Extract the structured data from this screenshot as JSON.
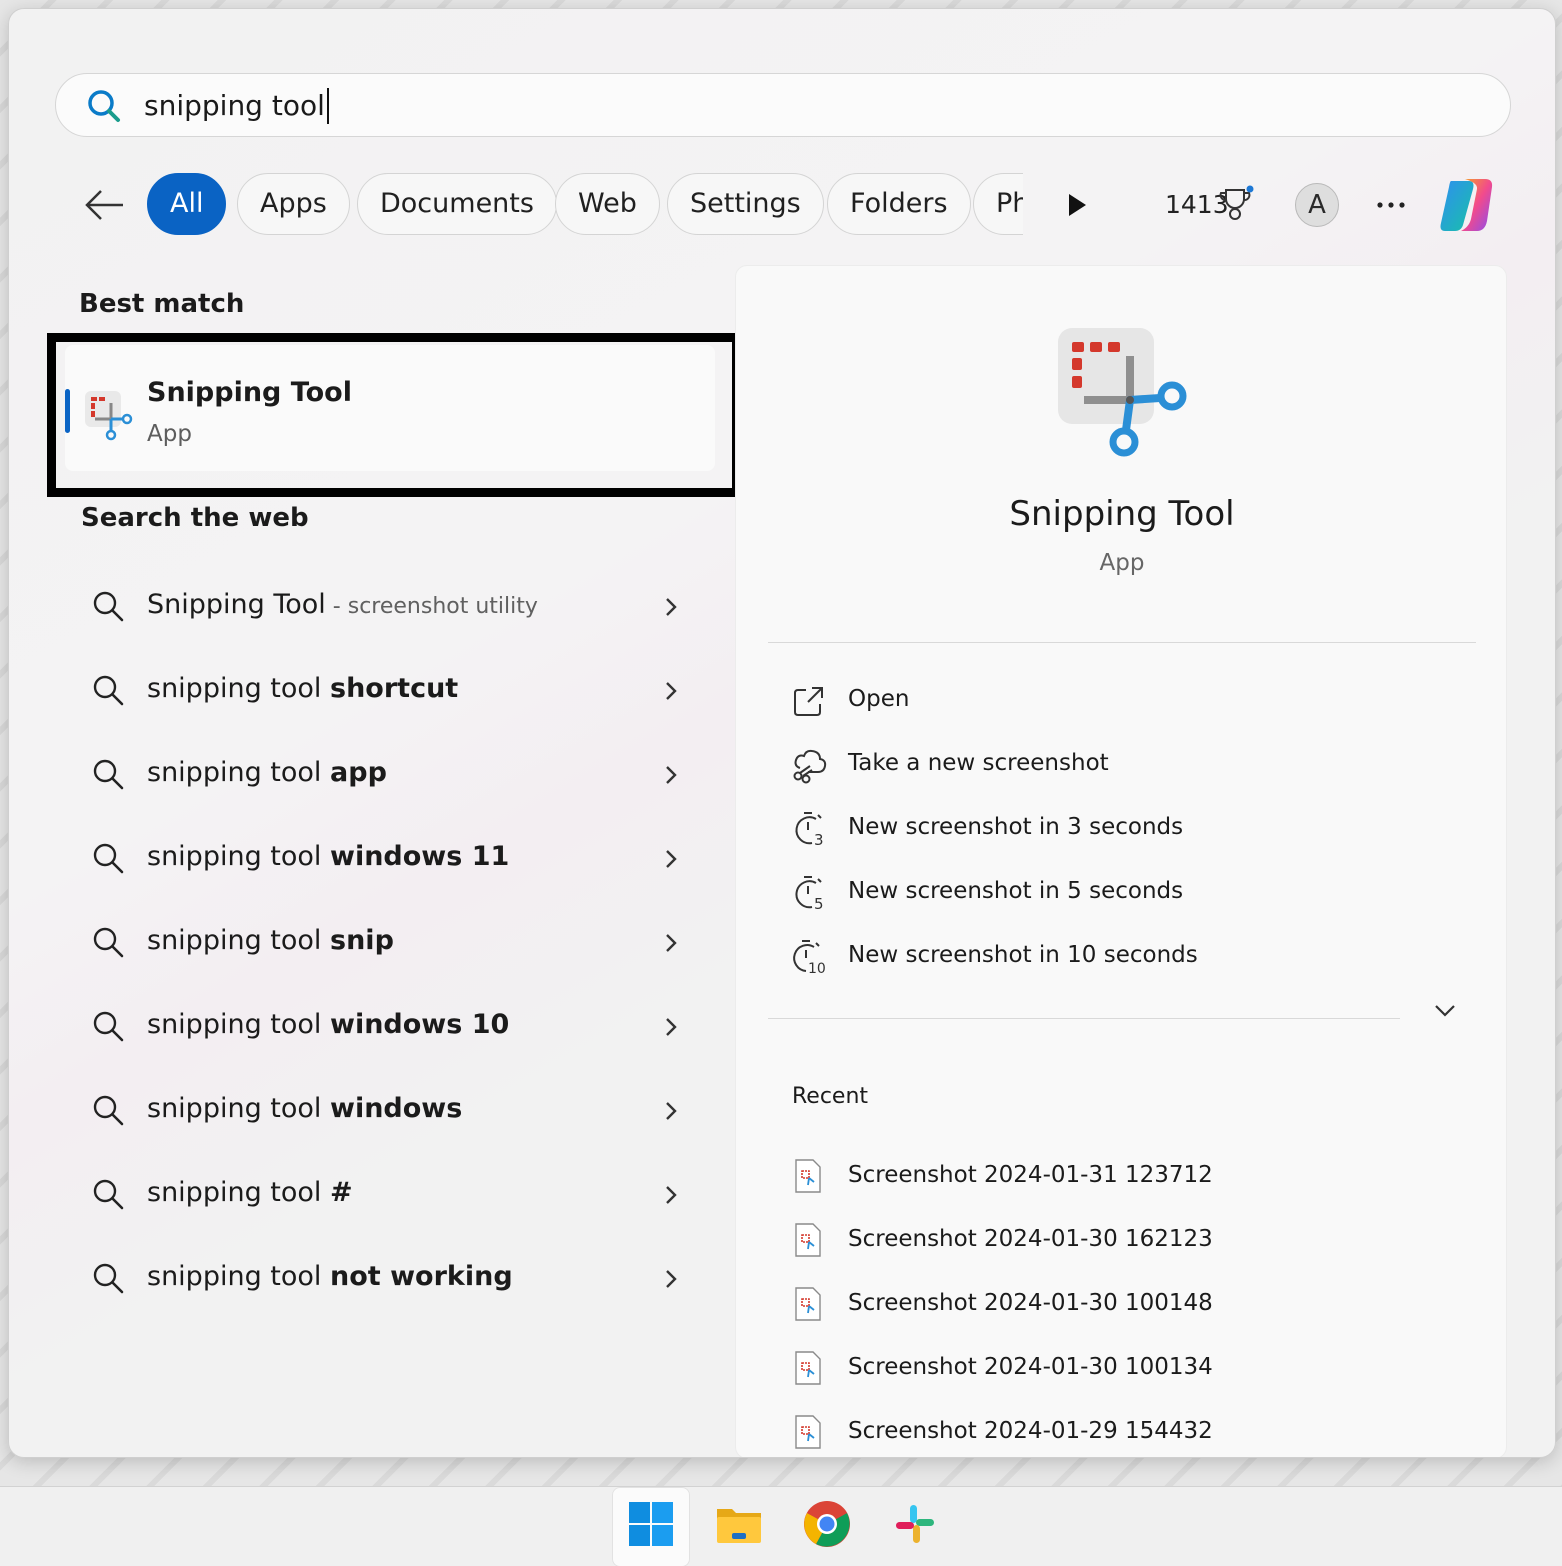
{
  "search": {
    "query": "snipping tool"
  },
  "filters": {
    "chips": [
      "All",
      "Apps",
      "Documents",
      "Web",
      "Settings",
      "Folders",
      "Ph"
    ],
    "points": "1413",
    "avatar_letter": "A"
  },
  "best_match": {
    "section_label": "Best match",
    "app_name": "Snipping Tool",
    "app_type": "App"
  },
  "web": {
    "section_label": "Search the web",
    "first_item": {
      "main": "Snipping Tool",
      "suffix": " - screenshot utility"
    },
    "prefix": "snipping tool ",
    "suggestions": [
      "shortcut",
      "app",
      "windows 11",
      "snip",
      "windows 10",
      "windows",
      "#",
      "not working"
    ]
  },
  "details": {
    "app_name": "Snipping Tool",
    "app_type": "App",
    "actions": [
      {
        "label": "Open",
        "icon": "open-external-icon"
      },
      {
        "label": "Take a new screenshot",
        "icon": "screenshot-snip-icon"
      },
      {
        "label": "New screenshot in 3 seconds",
        "icon": "timer-3-icon"
      },
      {
        "label": "New screenshot in 5 seconds",
        "icon": "timer-5-icon"
      },
      {
        "label": "New screenshot in 10 seconds",
        "icon": "timer-10-icon"
      }
    ],
    "recent_label": "Recent",
    "recent_files": [
      "Screenshot 2024-01-31 123712",
      "Screenshot 2024-01-30 162123",
      "Screenshot 2024-01-30 100148",
      "Screenshot 2024-01-30 100134",
      "Screenshot 2024-01-29 154432"
    ]
  },
  "taskbar": {
    "items": [
      "windows-start-icon",
      "file-explorer-icon",
      "chrome-icon",
      "slack-icon"
    ]
  },
  "colors": {
    "accent": "#0a63c4",
    "snip_red": "#d4382c",
    "snip_blue": "#2b8fd6"
  }
}
